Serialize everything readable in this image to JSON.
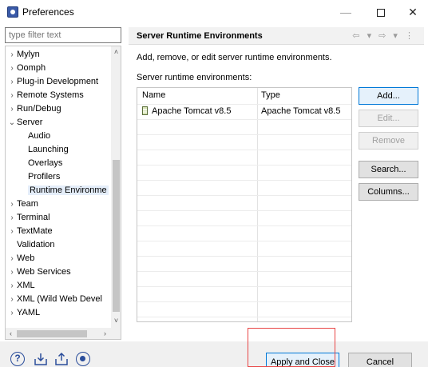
{
  "window": {
    "title": "Preferences",
    "minimize": "—",
    "close": "✕"
  },
  "filter": {
    "placeholder": "type filter text"
  },
  "tree": {
    "items": [
      {
        "label": "Mylyn",
        "arrow": "›",
        "level": 0
      },
      {
        "label": "Oomph",
        "arrow": "›",
        "level": 0
      },
      {
        "label": "Plug-in Development",
        "arrow": "›",
        "level": 0
      },
      {
        "label": "Remote Systems",
        "arrow": "›",
        "level": 0
      },
      {
        "label": "Run/Debug",
        "arrow": "›",
        "level": 0
      },
      {
        "label": "Server",
        "arrow": "⌄",
        "level": 0
      },
      {
        "label": "Audio",
        "arrow": "",
        "level": 1
      },
      {
        "label": "Launching",
        "arrow": "",
        "level": 1
      },
      {
        "label": "Overlays",
        "arrow": "",
        "level": 1
      },
      {
        "label": "Profilers",
        "arrow": "",
        "level": 1
      },
      {
        "label": "Runtime Environme",
        "arrow": "",
        "level": 1,
        "selected": true
      },
      {
        "label": "Team",
        "arrow": "›",
        "level": 0
      },
      {
        "label": "Terminal",
        "arrow": "›",
        "level": 0
      },
      {
        "label": "TextMate",
        "arrow": "›",
        "level": 0
      },
      {
        "label": "Validation",
        "arrow": "",
        "level": 0
      },
      {
        "label": "Web",
        "arrow": "›",
        "level": 0
      },
      {
        "label": "Web Services",
        "arrow": "›",
        "level": 0
      },
      {
        "label": "XML",
        "arrow": "›",
        "level": 0
      },
      {
        "label": "XML (Wild Web Devel",
        "arrow": "›",
        "level": 0
      },
      {
        "label": "YAML",
        "arrow": "›",
        "level": 0
      }
    ],
    "scroll_up": "˄",
    "scroll_down": "˅",
    "scroll_left": "‹",
    "scroll_right": "›"
  },
  "page": {
    "title": "Server Runtime Environments",
    "nav_icons": "⇦ ▾ ⇨ ▾ ⋮",
    "description": "Add, remove, or edit server runtime environments.",
    "table_caption": "Server runtime environments:"
  },
  "table": {
    "headers": {
      "name": "Name",
      "type": "Type"
    },
    "rows": [
      {
        "name": "Apache Tomcat v8.5",
        "type": "Apache Tomcat v8.5"
      }
    ]
  },
  "buttons": {
    "add": "Add...",
    "edit": "Edit...",
    "remove": "Remove",
    "search": "Search...",
    "columns": "Columns...",
    "apply_close": "Apply and Close",
    "cancel": "Cancel",
    "help": "?"
  }
}
